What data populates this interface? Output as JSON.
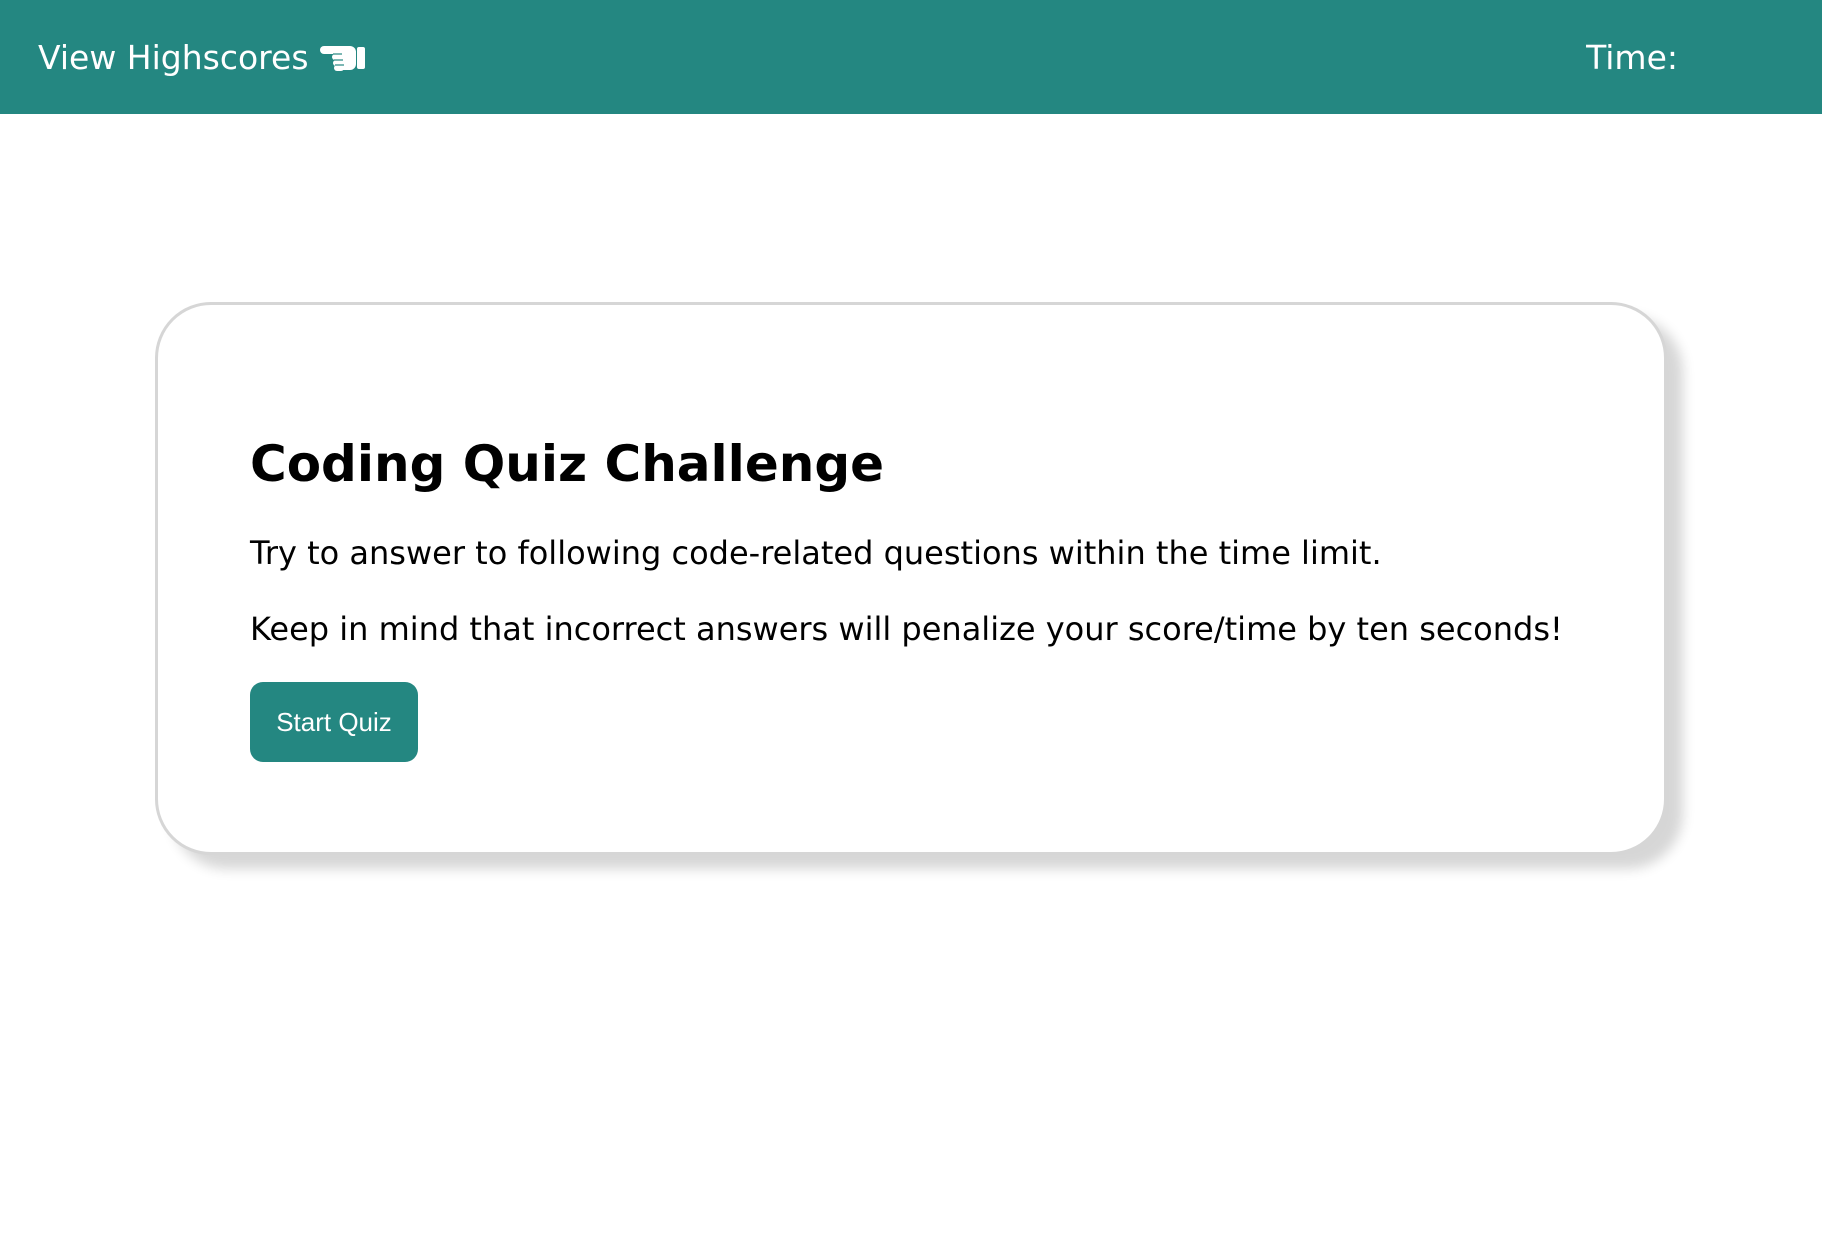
{
  "header": {
    "highscores_label": "View Highscores",
    "highscores_icon": "pointing-hand-icon",
    "timer_label": "Time:",
    "timer_value": ""
  },
  "quiz": {
    "title": "Coding Quiz Challenge",
    "paragraphs": [
      "Try to answer to following code-related questions within the time limit.",
      "Keep in mind that incorrect answers will penalize your score/time by ten seconds!"
    ],
    "start_label": "Start Quiz"
  },
  "colors": {
    "accent": "#248781",
    "card_border": "#d6d6d6",
    "text": "#000000",
    "background": "#ffffff"
  }
}
